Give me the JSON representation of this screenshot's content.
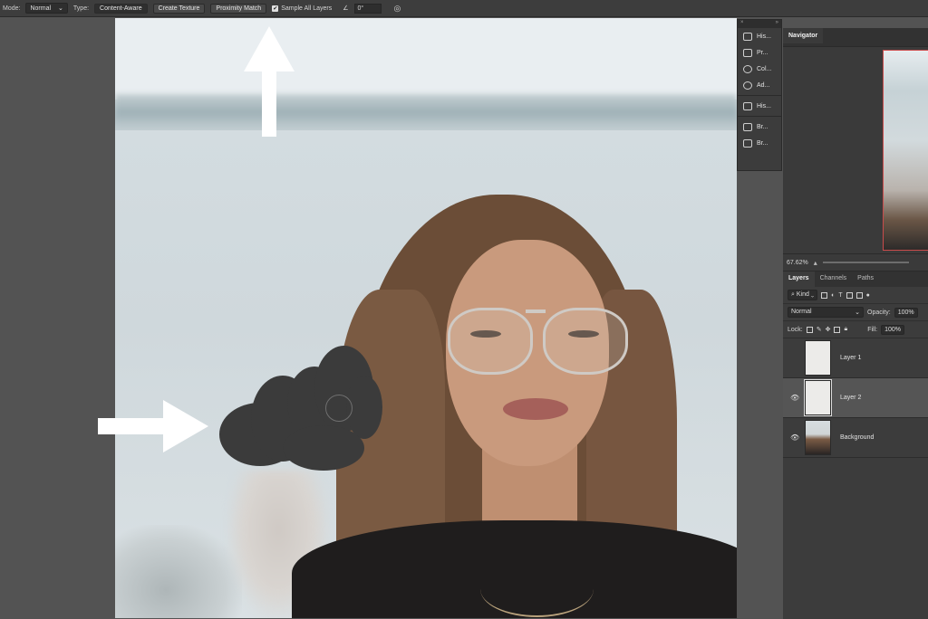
{
  "options_bar": {
    "mode_label": "Mode:",
    "mode_value": "Normal",
    "type_label": "Type:",
    "type_buttons": [
      "Content-Aware",
      "Create Texture",
      "Proximity Match"
    ],
    "sample_all_layers": "Sample All Layers",
    "sample_all_checked": true,
    "angle_value": "0°"
  },
  "icon_panel": {
    "items": [
      "His...",
      "Pr...",
      "Col...",
      "Ad...",
      "His...",
      "Br...",
      "Br..."
    ]
  },
  "navigator": {
    "tab": "Navigator",
    "zoom": "67.62%"
  },
  "layers_panel": {
    "tabs": [
      "Layers",
      "Channels",
      "Paths"
    ],
    "filter_kind": "Kind",
    "blend_mode": "Normal",
    "opacity_label": "Opacity:",
    "opacity_value": "100%",
    "lock_label": "Lock:",
    "fill_label": "Fill:",
    "fill_value": "100%",
    "layers": [
      {
        "name": "Layer 1",
        "visible": false,
        "selected": false
      },
      {
        "name": "Layer 2",
        "visible": true,
        "selected": true
      },
      {
        "name": "Background",
        "visible": true,
        "selected": false
      }
    ]
  },
  "colors": {
    "app_bg": "#535353",
    "panel_bg": "#3c3c3c",
    "mask": "#3b3b3b",
    "selected_layer": "#555555"
  }
}
